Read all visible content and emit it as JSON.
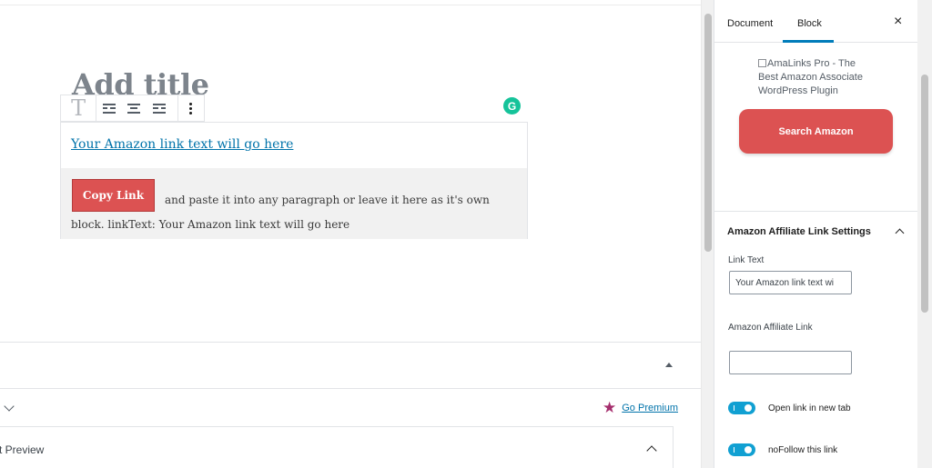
{
  "editor": {
    "title_placeholder": "Add title",
    "toolbar": {
      "block_type_glyph": "T",
      "align_left_icon": "align-left-icon",
      "align_center_icon": "align-center-icon",
      "align_right_icon": "align-right-icon",
      "more_icon": "more-vertical-icon"
    },
    "grammarly_glyph": "G",
    "amazon_block": {
      "link_text": "Your Amazon link text will go here",
      "copy_button": "Copy Link",
      "instructions": "and paste it into any paragraph or leave it here as it's own block. linkText: Your Amazon link text will go here"
    },
    "go_premium": "Go Premium",
    "preview_label": "t Preview"
  },
  "sidebar": {
    "tabs": [
      "Document",
      "Block"
    ],
    "active_tab": "Block",
    "close_glyph": "×",
    "logo_alt": "AmaLinks Pro - The Best Amazon Associate WordPress Plugin",
    "search_button": "Search Amazon",
    "panel_title": "Amazon Affiliate Link Settings",
    "link_text_label": "Link Text",
    "link_text_value": "Your Amazon link text wi",
    "affiliate_link_label": "Amazon Affiliate Link",
    "affiliate_link_value": "",
    "toggle_new_tab_label": "Open link in new tab",
    "toggle_nofollow_label": "noFollow this link"
  },
  "colors": {
    "accent_red": "#dc5252",
    "link_blue": "#0073aa",
    "toggle_blue": "#11a0d2",
    "premium_star": "#a52e6d"
  }
}
